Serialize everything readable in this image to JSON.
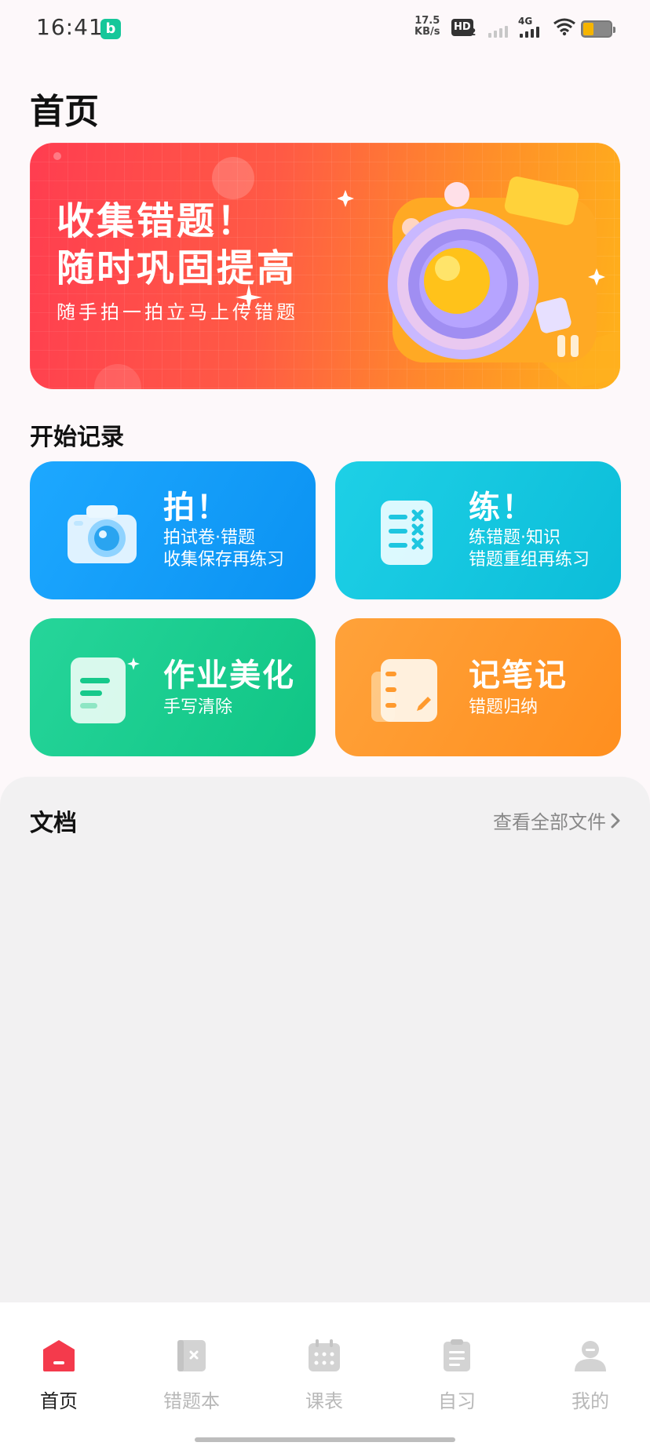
{
  "status_bar": {
    "time": "16:41",
    "app_badge": "b",
    "net_speed_value": "17.5",
    "net_speed_unit": "KB/s",
    "hd_label": "HD",
    "hd_sub": "2",
    "network_type": "4G"
  },
  "page": {
    "title": "首页"
  },
  "banner": {
    "headline_line1": "收集错题！",
    "headline_line2": "随时巩固提高",
    "subtitle": "随手拍一拍立马上传错题"
  },
  "start_section": {
    "title": "开始记录"
  },
  "cards": [
    {
      "title": "拍！",
      "desc": "拍试卷·错题\n收集保存再练习",
      "icon": "camera-icon",
      "color": "#1aa4ff"
    },
    {
      "title": "练！",
      "desc": "练错题·知识\n错题重组再练习",
      "icon": "practice-list-icon",
      "color": "#14c6e0"
    },
    {
      "title": "作业美化",
      "desc": "手写清除",
      "icon": "document-beautify-icon",
      "color": "#1fcf90"
    },
    {
      "title": "记笔记",
      "desc": "错题归纳",
      "icon": "notebook-icon",
      "color": "#ff9a2e"
    }
  ],
  "documents": {
    "title": "文档",
    "view_all": "查看全部文件"
  },
  "tabs": [
    {
      "label": "首页",
      "icon": "home-icon",
      "active": true
    },
    {
      "label": "错题本",
      "icon": "mistake-book-icon",
      "active": false
    },
    {
      "label": "课表",
      "icon": "calendar-icon",
      "active": false
    },
    {
      "label": "自习",
      "icon": "clipboard-icon",
      "active": false
    },
    {
      "label": "我的",
      "icon": "profile-icon",
      "active": false
    }
  ],
  "colors": {
    "accent": "#f43a4c",
    "background": "#fdf8fa",
    "panel": "#f2f1f2"
  }
}
